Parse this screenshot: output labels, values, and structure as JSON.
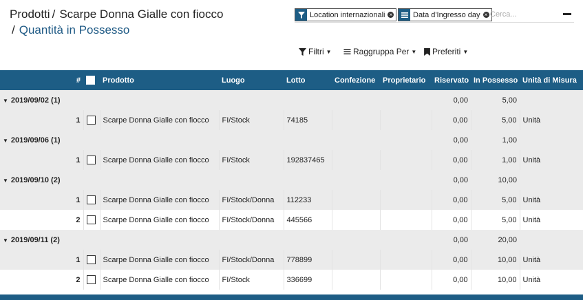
{
  "breadcrumb": {
    "item1": "Prodotti",
    "separator": "/",
    "item2": "Scarpe Donna Gialle con fiocco",
    "current": "Quantità in Possesso"
  },
  "search": {
    "facets": [
      {
        "label": "Location internazionali",
        "icon": "filter-icon"
      },
      {
        "label": "Data d'Ingresso day",
        "icon": "group-by-icon"
      }
    ],
    "placeholder": "Cerca..."
  },
  "toolbar": {
    "filters": "Filtri",
    "group_by": "Raggruppa Per",
    "favorites": "Preferiti"
  },
  "table": {
    "headers": [
      "#",
      "",
      "Prodotto",
      "Luogo",
      "Lotto",
      "Confezione",
      "Proprietario",
      "Riservato",
      "In Possesso",
      "Unità di Misura"
    ],
    "groups": [
      {
        "label": "2019/09/02 (1)",
        "reserved": "0,00",
        "on_hand": "5,00",
        "rows": [
          {
            "num": "1",
            "product": "Scarpe Donna Gialle con fiocco",
            "location": "FI/Stock",
            "lot": "74185",
            "package": "",
            "owner": "",
            "reserved": "0,00",
            "on_hand": "5,00",
            "uom": "Unità"
          }
        ]
      },
      {
        "label": "2019/09/06 (1)",
        "reserved": "0,00",
        "on_hand": "1,00",
        "rows": [
          {
            "num": "1",
            "product": "Scarpe Donna Gialle con fiocco",
            "location": "FI/Stock",
            "lot": "192837465",
            "package": "",
            "owner": "",
            "reserved": "0,00",
            "on_hand": "1,00",
            "uom": "Unità"
          }
        ]
      },
      {
        "label": "2019/09/10 (2)",
        "reserved": "0,00",
        "on_hand": "10,00",
        "rows": [
          {
            "num": "1",
            "product": "Scarpe Donna Gialle con fiocco",
            "location": "FI/Stock/Donna",
            "lot": "112233",
            "package": "",
            "owner": "",
            "reserved": "0,00",
            "on_hand": "5,00",
            "uom": "Unità"
          },
          {
            "num": "2",
            "product": "Scarpe Donna Gialle con fiocco",
            "location": "FI/Stock/Donna",
            "lot": "445566",
            "package": "",
            "owner": "",
            "reserved": "0,00",
            "on_hand": "5,00",
            "uom": "Unità"
          }
        ]
      },
      {
        "label": "2019/09/11 (2)",
        "reserved": "0,00",
        "on_hand": "20,00",
        "rows": [
          {
            "num": "1",
            "product": "Scarpe Donna Gialle con fiocco",
            "location": "FI/Stock/Donna",
            "lot": "778899",
            "package": "",
            "owner": "",
            "reserved": "0,00",
            "on_hand": "10,00",
            "uom": "Unità"
          },
          {
            "num": "2",
            "product": "Scarpe Donna Gialle con fiocco",
            "location": "FI/Stock",
            "lot": "336699",
            "package": "",
            "owner": "",
            "reserved": "0,00",
            "on_hand": "10,00",
            "uom": "Unità"
          }
        ]
      }
    ]
  },
  "colors": {
    "header": "#1d5d85",
    "link": "#1f5a85",
    "group_bg": "#ebebeb"
  }
}
